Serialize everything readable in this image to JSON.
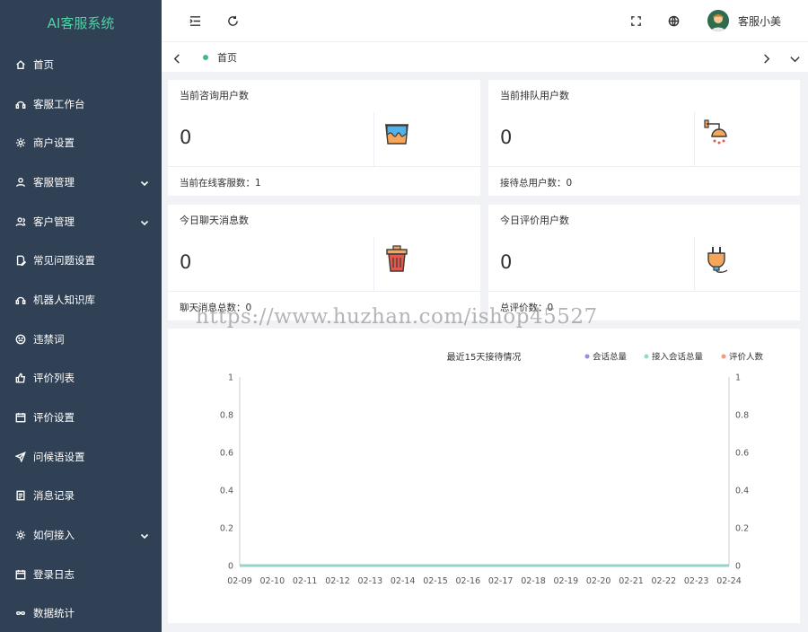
{
  "app": {
    "logo_text": "AI客服系统"
  },
  "sidebar": {
    "items": [
      {
        "label": "首页",
        "icon": "home-icon",
        "has_arrow": false
      },
      {
        "label": "客服工作台",
        "icon": "headset-icon",
        "has_arrow": false
      },
      {
        "label": "商户设置",
        "icon": "gear-icon",
        "has_arrow": false
      },
      {
        "label": "客服管理",
        "icon": "user-icon",
        "has_arrow": true
      },
      {
        "label": "客户管理",
        "icon": "users-icon",
        "has_arrow": true
      },
      {
        "label": "常见问题设置",
        "icon": "edit-doc-icon",
        "has_arrow": false
      },
      {
        "label": "机器人知识库",
        "icon": "headset-icon",
        "has_arrow": false
      },
      {
        "label": "违禁词",
        "icon": "face-icon",
        "has_arrow": false
      },
      {
        "label": "评价列表",
        "icon": "thumbs-up-icon",
        "has_arrow": false
      },
      {
        "label": "评价设置",
        "icon": "calendar-icon",
        "has_arrow": false
      },
      {
        "label": "问候语设置",
        "icon": "send-icon",
        "has_arrow": false
      },
      {
        "label": "消息记录",
        "icon": "document-icon",
        "has_arrow": false
      },
      {
        "label": "如何接入",
        "icon": "gear-icon",
        "has_arrow": true
      },
      {
        "label": "登录日志",
        "icon": "calendar-icon",
        "has_arrow": false
      },
      {
        "label": "数据统计",
        "icon": "infinity-icon",
        "has_arrow": false
      }
    ]
  },
  "header": {
    "username": "客服小美",
    "icons": [
      "menu-toggle-icon",
      "refresh-icon",
      "fullscreen-icon",
      "globe-icon"
    ]
  },
  "tabs": {
    "items": [
      {
        "label": "首页",
        "active": true
      }
    ]
  },
  "cards": [
    {
      "title": "当前咨询用户数",
      "value": "0",
      "footer": "当前在线客服数：1",
      "icon": "paint-bucket-icon"
    },
    {
      "title": "当前排队用户数",
      "value": "0",
      "footer": "接待总用户数：0",
      "icon": "shower-icon"
    },
    {
      "title": "今日聊天消息数",
      "value": "0",
      "footer": "聊天消息总数：0",
      "icon": "trash-can-icon"
    },
    {
      "title": "今日评价用户数",
      "value": "0",
      "footer": "总评价数：0",
      "icon": "plug-icon"
    }
  ],
  "watermark": "https://www.huzhan.com/ishop45527",
  "chart_data": {
    "type": "line",
    "title": "最近15天接待情况",
    "categories": [
      "02-09",
      "02-10",
      "02-11",
      "02-12",
      "02-13",
      "02-14",
      "02-15",
      "02-16",
      "02-17",
      "02-18",
      "02-19",
      "02-20",
      "02-21",
      "02-22",
      "02-23",
      "02-24"
    ],
    "series": [
      {
        "name": "会话总量",
        "color": "#9b8fd9",
        "values": [
          0,
          0,
          0,
          0,
          0,
          0,
          0,
          0,
          0,
          0,
          0,
          0,
          0,
          0,
          0,
          0
        ]
      },
      {
        "name": "接入会话总量",
        "color": "#91dcc5",
        "values": [
          0,
          0,
          0,
          0,
          0,
          0,
          0,
          0,
          0,
          0,
          0,
          0,
          0,
          0,
          0,
          0
        ]
      },
      {
        "name": "评价人数",
        "color": "#f29a82",
        "values": [
          0,
          0,
          0,
          0,
          0,
          0,
          0,
          0,
          0,
          0,
          0,
          0,
          0,
          0,
          0,
          0
        ]
      }
    ],
    "ylim": [
      0,
      1
    ],
    "yticks": [
      "0",
      "0.2",
      "0.4",
      "0.6",
      "0.8",
      "1"
    ],
    "legend": "top-right",
    "dual_y_axis": true,
    "grid": false
  }
}
